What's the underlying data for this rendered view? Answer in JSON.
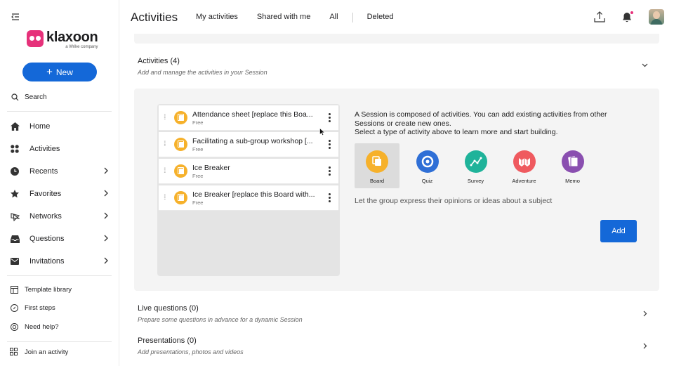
{
  "sidebar": {
    "logo": {
      "name": "klaxoon",
      "tagline": "a Wrike company"
    },
    "new_button": "New",
    "search_label": "Search",
    "nav": [
      {
        "label": "Home",
        "icon": "home-icon",
        "has_chevron": false
      },
      {
        "label": "Activities",
        "icon": "grid-icon",
        "has_chevron": false
      },
      {
        "label": "Recents",
        "icon": "clock-icon",
        "has_chevron": true
      },
      {
        "label": "Favorites",
        "icon": "star-icon",
        "has_chevron": true
      },
      {
        "label": "Networks",
        "icon": "network-icon",
        "has_chevron": true
      },
      {
        "label": "Questions",
        "icon": "inbox-icon",
        "has_chevron": true
      },
      {
        "label": "Invitations",
        "icon": "mail-icon",
        "has_chevron": true
      }
    ],
    "secondary": [
      {
        "label": "Template library",
        "icon": "template-icon"
      },
      {
        "label": "First steps",
        "icon": "compass-icon"
      },
      {
        "label": "Need help?",
        "icon": "help-icon"
      }
    ],
    "join_label": "Join an activity"
  },
  "header": {
    "title": "Activities",
    "tabs": [
      "My activities",
      "Shared with me",
      "All",
      "Deleted"
    ]
  },
  "activities_section": {
    "title": "Activities",
    "count": "(4)",
    "subtitle": "Add and manage the activities in your Session",
    "items": [
      {
        "title": "Attendance sheet [replace this Boa...",
        "sub": "Free"
      },
      {
        "title": "Facilitating a sub-group workshop [...",
        "sub": "Free"
      },
      {
        "title": "Ice Breaker",
        "sub": "Free"
      },
      {
        "title": "Ice Breaker [replace this Board with...",
        "sub": "Free"
      }
    ],
    "description_line1": "A Session is composed of activities. You can add existing activities from other",
    "description_line2": "Sessions or create new ones.",
    "description_line3": "Select a type of activity above to learn more and start building.",
    "types": [
      {
        "label": "Board",
        "color": "#f6b12b",
        "icon": "board-icon",
        "selected": true
      },
      {
        "label": "Quiz",
        "color": "#2f6fd6",
        "icon": "quiz-icon",
        "selected": false
      },
      {
        "label": "Survey",
        "color": "#1fb39a",
        "icon": "survey-icon",
        "selected": false
      },
      {
        "label": "Adventure",
        "color": "#ef5a5f",
        "icon": "adventure-icon",
        "selected": false
      },
      {
        "label": "Memo",
        "color": "#8a4fb0",
        "icon": "memo-icon",
        "selected": false
      }
    ],
    "type_hint": "Let the group express their opinions or ideas about a subject",
    "add_button": "Add"
  },
  "live_questions": {
    "title": "Live questions",
    "count": "(0)",
    "subtitle": "Prepare some questions in advance for a dynamic Session"
  },
  "presentations": {
    "title": "Presentations",
    "count": "(0)",
    "subtitle": "Add presentations, photos and videos"
  },
  "colors": {
    "accent": "#1468d8",
    "brand": "#e6317a"
  }
}
